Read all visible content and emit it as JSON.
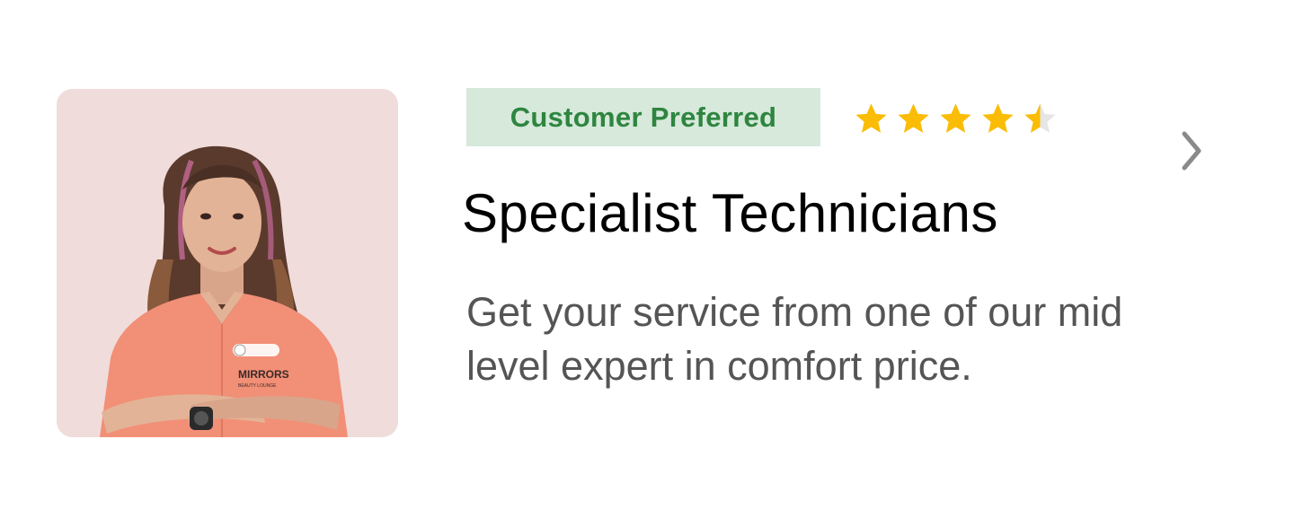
{
  "card": {
    "badge_label": "Customer Preferred",
    "title": "Specialist Technicians",
    "description": "Get your service from one of our mid level expert in comfort price.",
    "rating": {
      "value": 4.5,
      "max": 5
    },
    "photo": {
      "uniform_text": "MIRRORS",
      "uniform_subtext": "BEAUTY LOUNGE"
    },
    "next_icon": "chevron-right-icon"
  },
  "colors": {
    "badge_bg": "#d6e9da",
    "badge_text": "#2e8540",
    "star_filled": "#fbbc05",
    "star_empty": "#e6e6e6",
    "photo_bg": "#f0dcda",
    "uniform": "#f28f77",
    "chevron": "#8a8a8a"
  }
}
